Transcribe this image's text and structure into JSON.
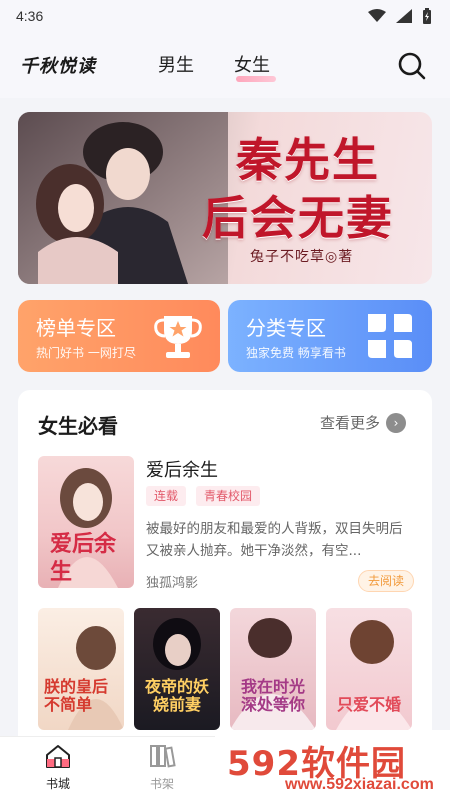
{
  "status_bar": {
    "time": "4:36"
  },
  "header": {
    "brand": "千秋悦读",
    "tabs": [
      {
        "label": "男生"
      },
      {
        "label": "女生",
        "active": true
      }
    ]
  },
  "banner": {
    "title_line1": "秦先生",
    "title_line2": "后会无妻",
    "author": "兔子不吃草◎著"
  },
  "shortcuts": [
    {
      "title": "榜单专区",
      "subtitle": "热门好书 一网打尽",
      "icon": "trophy-icon",
      "color": "#ff8a5c"
    },
    {
      "title": "分类专区",
      "subtitle": "独家免费 畅享看书",
      "icon": "clover-icon",
      "color": "#5a8ef7"
    }
  ],
  "section": {
    "title": "女生必看",
    "more_label": "查看更多",
    "featured": {
      "title": "爱后余生",
      "tags": [
        "连载",
        "青春校园"
      ],
      "description": "被最好的朋友和最爱的人背叛，双目失明后又被亲人抛弃。她干净淡然，有空...",
      "author": "独孤鸿影",
      "read_label": "去阅读",
      "cover_text": "爱后余生"
    },
    "books": [
      {
        "cover_text": "朕的皇后不简单"
      },
      {
        "cover_text": "夜帝的妖娆前妻"
      },
      {
        "cover_text": "我在时光深处等你"
      },
      {
        "cover_text": "只爱不婚"
      }
    ]
  },
  "bottom_nav": [
    {
      "label": "书城",
      "icon": "home-icon",
      "active": true
    },
    {
      "label": "书架",
      "icon": "bookshelf-icon"
    }
  ],
  "watermark": {
    "text": "592软件园",
    "url": "www.592xiazai.com"
  },
  "colors": {
    "accent_pink": "#e25a6b",
    "background": "#f3f4f8"
  }
}
